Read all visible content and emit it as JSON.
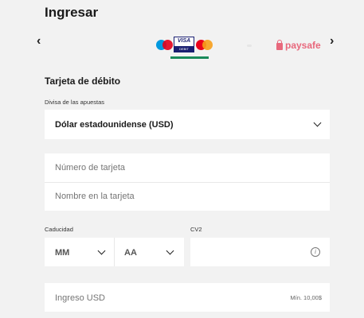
{
  "page": {
    "title": "Ingresar"
  },
  "methods": {
    "prev_arrow": "‹",
    "next_arrow": "›",
    "visa_text": "VISA",
    "visa_sub": "DEBIT",
    "paysafe_label": "paysafe"
  },
  "form": {
    "section_title": "Tarjeta de débito",
    "currency_label": "Divisa de las apuestas",
    "currency_value": "Dólar estadounidense (USD)",
    "card_number_placeholder": "Número de tarjeta",
    "card_name_placeholder": "Nombre en la tarjeta",
    "expiry_label": "Caducidad",
    "expiry_month": "MM",
    "expiry_year": "AA",
    "cv2_label": "CV2",
    "amount_placeholder": "Ingreso USD",
    "amount_min": "Mín. 10,00$"
  },
  "colors": {
    "background": "#f2f2f2",
    "selected_underline": "#1a8a5a",
    "paysafe": "#e8687c"
  }
}
